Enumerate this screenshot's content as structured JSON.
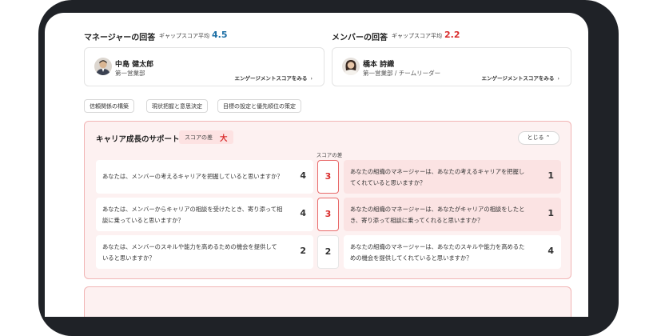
{
  "manager": {
    "section_title": "マネージャーの回答",
    "gap_label": "ギャップスコア平均",
    "gap_score": "4.5",
    "name": "中島 健太郎",
    "department": "第一営業部",
    "link_label": "エンゲージメントスコアをみる",
    "link_chevron": "›"
  },
  "member": {
    "section_title": "メンバーの回答",
    "gap_label": "ギャップスコア平均",
    "gap_score": "2.2",
    "name": "橋本 詩織",
    "department": "第一営業部 / チームリーダー",
    "link_label": "エンゲージメントスコアをみる",
    "link_chevron": "›"
  },
  "tags": [
    "信頼関係の構築",
    "現状把握と意思決定",
    "目標の設定と優先順位の策定"
  ],
  "category": {
    "title": "キャリア成長のサポート",
    "diff_label": "スコアの差",
    "diff_value": "大",
    "toggle_label": "とじる ⌃",
    "column_header": "スコアの差"
  },
  "rows": [
    {
      "manager_q": "あなたは、メンバーの考えるキャリアを把握していると思いますか？",
      "manager_score": "4",
      "diff": "3",
      "member_q_1": "あなたの組織のマネージャーは、あなたの考えるキャリアを把握し",
      "member_q_2": "てくれていると思いますか？",
      "member_score": "1"
    },
    {
      "manager_q_1": "あなたは、メンバーからキャリアの相談を受けたとき、寄り添って相",
      "manager_q_2": "談に乗っていると思いますか？",
      "manager_score": "4",
      "diff": "3",
      "member_q_1": "あなたの組織のマネージャーは、あなたがキャリアの相談をしたと",
      "member_q_2": "き、寄り添って相談に乗ってくれると思いますか？",
      "member_score": "1"
    },
    {
      "manager_q_1": "あなたは、メンバーのスキルや能力を高めるための機会を提供して",
      "manager_q_2": "いると思いますか？",
      "manager_score": "2",
      "diff": "2",
      "member_q_1": "あなたの組織のマネージャーは、あなたのスキルや能力を高めるた",
      "member_q_2": "めの機会を提供してくれていると思いますか？",
      "member_score": "4"
    }
  ],
  "colors": {
    "manager_score": "#1d6fa5",
    "member_score": "#d92c2c",
    "accent_red": "#d92c2c",
    "panel_bg": "#fdf1f1",
    "panel_border": "#f1b5b5"
  }
}
